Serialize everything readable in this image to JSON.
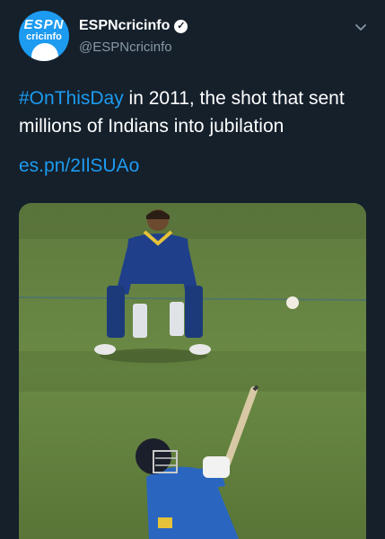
{
  "author": {
    "name": "ESPNcricinfo",
    "handle": "@ESPNcricinfo",
    "avatar_text_top": "ESPN",
    "avatar_text_bottom": "cricinfo",
    "verified": true
  },
  "tweet": {
    "hashtag": "#OnThisDay",
    "text": " in 2011, the shot that sent millions of Indians into jubilation",
    "link": "es.pn/2IlSUAo"
  },
  "icons": {
    "verified": "verified-badge-icon",
    "menu": "chevron-down-icon"
  },
  "colors": {
    "background": "#15202b",
    "accent": "#1d9bf0",
    "secondary_text": "#8899a6"
  }
}
